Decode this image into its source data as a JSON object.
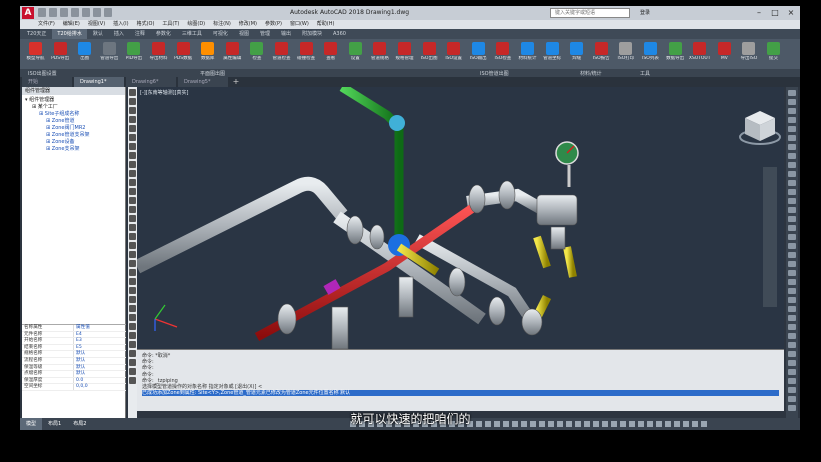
{
  "window": {
    "title": "Autodesk AutoCAD 2018   Drawing1.dwg",
    "search_placeholder": "键入关键字或短语",
    "user_label": "登录"
  },
  "menubar": [
    "文件(F)",
    "编辑(E)",
    "视图(V)",
    "插入(I)",
    "格式(O)",
    "工具(T)",
    "绘图(D)",
    "标注(N)",
    "修改(M)",
    "参数(P)",
    "窗口(W)",
    "帮助(H)"
  ],
  "ribbon_tabs": [
    {
      "label": "T20天正"
    },
    {
      "label": "T20给排水",
      "active": true
    },
    {
      "label": "默认"
    },
    {
      "label": "插入"
    },
    {
      "label": "注释"
    },
    {
      "label": "参数化"
    },
    {
      "label": "三维工具"
    },
    {
      "label": "可视化"
    },
    {
      "label": "视图"
    },
    {
      "label": "管理"
    },
    {
      "label": "输出"
    },
    {
      "label": "附加模块"
    },
    {
      "label": "A360"
    }
  ],
  "ribbon_buttons": [
    {
      "label": "模型导航",
      "color": "#d9312b"
    },
    {
      "label": "PDS导出",
      "color": "#c62828"
    },
    {
      "label": "出图",
      "color": "#1e88e5"
    },
    {
      "label": "管道导出",
      "color": "#6d7680"
    },
    {
      "label": "PID导出",
      "color": "#43a047"
    },
    {
      "label": "导出材料",
      "color": "#c62828"
    },
    {
      "label": "PDS数据",
      "color": "#c62828"
    },
    {
      "label": "数据库",
      "color": "#ff8f00"
    },
    {
      "label": "属性编辑",
      "color": "#c62828"
    },
    {
      "label": "检查",
      "color": "#43a047"
    },
    {
      "label": "管道检查",
      "color": "#c62828"
    },
    {
      "label": "碰撞检查",
      "color": "#c62828"
    },
    {
      "label": "查看",
      "color": "#c62828"
    },
    {
      "label": "设置",
      "color": "#43a047"
    },
    {
      "label": "管道规格",
      "color": "#c62828"
    },
    {
      "label": "规格管理",
      "color": "#c62828"
    },
    {
      "label": "ISO出图",
      "color": "#c62828"
    },
    {
      "label": "ISO设置",
      "color": "#c62828"
    },
    {
      "label": "ISO输出",
      "color": "#1e88e5"
    },
    {
      "label": "ISO检查",
      "color": "#c62828"
    },
    {
      "label": "材料统计",
      "color": "#1e88e5"
    },
    {
      "label": "管道坐标",
      "color": "#1e88e5"
    },
    {
      "label": "焊缝",
      "color": "#1e88e5"
    },
    {
      "label": "ISO报告",
      "color": "#c62828"
    },
    {
      "label": "ISO打印",
      "color": "#9e9e9e"
    },
    {
      "label": "ISO列表",
      "color": "#1e88e5"
    },
    {
      "label": "数据导出",
      "color": "#43a047"
    },
    {
      "label": "XSUTOUT",
      "color": "#c62828"
    },
    {
      "label": "MV",
      "color": "#c62828"
    },
    {
      "label": "导出ISO",
      "color": "#9e9e9e"
    },
    {
      "label": "提交",
      "color": "#43a047"
    }
  ],
  "ribbon_panels": [
    "ISO出图设置",
    "平面图出图",
    "ISO管道出图",
    "材料/统计",
    "工具"
  ],
  "doc_tabs": [
    {
      "label": "开始",
      "active": false
    },
    {
      "label": "Drawing1*",
      "active": true
    },
    {
      "label": "Drawing6*",
      "active": false
    },
    {
      "label": "Drawing5*",
      "active": false
    }
  ],
  "left_panel": {
    "title": "组件管理器",
    "tree": [
      {
        "label": "组件管理器",
        "level": 0,
        "blue": false
      },
      {
        "label": "某个工厂",
        "level": 1,
        "blue": false
      },
      {
        "label": "Site子组成名称",
        "level": 2,
        "blue": true
      },
      {
        "label": "Zone管道",
        "level": 3,
        "blue": true
      },
      {
        "label": "Zone阀门MR2",
        "level": 3,
        "blue": true
      },
      {
        "label": "Zone管道支吊架",
        "level": 3,
        "blue": true
      },
      {
        "label": "Zone设备",
        "level": 3,
        "blue": true
      },
      {
        "label": "Zone支吊架",
        "level": 3,
        "blue": true
      }
    ],
    "properties": [
      {
        "key": "名称属性",
        "value": "属性值"
      },
      {
        "key": "元件名称",
        "value": "E4"
      },
      {
        "key": "开始名称",
        "value": "E3"
      },
      {
        "key": "结束名称",
        "value": "E5"
      },
      {
        "key": "规格名称",
        "value": "默认"
      },
      {
        "key": "流程名称",
        "value": "默认"
      },
      {
        "key": "保温等级",
        "value": "默认"
      },
      {
        "key": "点缀名称",
        "value": "默认"
      },
      {
        "key": "保温厚度",
        "value": "0.0"
      },
      {
        "key": "空间坐标",
        "value": "0,0,0"
      }
    ]
  },
  "viewport": {
    "label": "[-][东南等轴测][真实]",
    "viewcube_label": "上"
  },
  "command_lines": [
    {
      "text": "命令: *取消*",
      "highlight": false
    },
    {
      "text": "命令:",
      "highlight": false
    },
    {
      "text": "命令:",
      "highlight": false
    },
    {
      "text": "命令:",
      "highlight": false
    },
    {
      "text": "命令: _tzpiping",
      "highlight": false
    },
    {
      "text": "选择模型管道操作的对象名称  指定对象或 [退出(X)] <",
      "highlight": false
    },
    {
      "text": "已成功添加Zone到属性: Site<Y>,Zone管道_管道元素已修改为管道Zone元件位置名称 默认",
      "highlight": true
    }
  ],
  "layout_tabs": [
    {
      "label": "模型",
      "active": true
    },
    {
      "label": "布局1",
      "active": false
    },
    {
      "label": "布局2",
      "active": false
    }
  ],
  "status_text": "就可以快速的把咱们的",
  "colors": {
    "pipe_red": "#d32020",
    "pipe_green": "#1fa22a",
    "pipe_yellow": "#d3c21a",
    "pipe_grey": "#b9bec4",
    "pipe_blue": "#1c6fe0",
    "viewport_bg": "#2a3544"
  }
}
